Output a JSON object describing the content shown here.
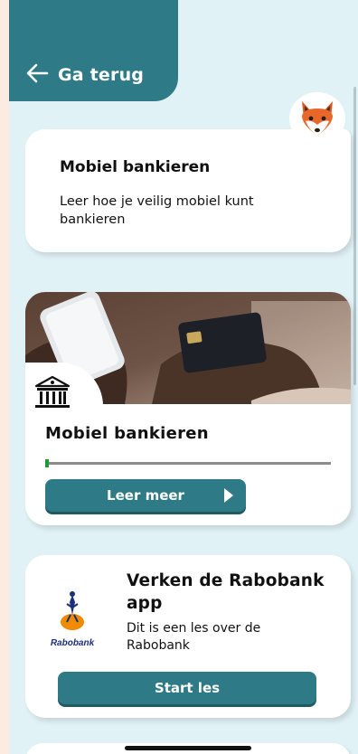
{
  "header": {
    "back_label": "Ga terug"
  },
  "intro": {
    "title": "Mobiel bankieren",
    "description": "Leer hoe je veilig mobiel kunt bankieren"
  },
  "course": {
    "title": "Mobiel bankieren",
    "progress": 0.01,
    "button_label": "Leer meer",
    "icon": "bank-building-icon"
  },
  "rabobank": {
    "title": "Verken de Rabobank app",
    "description": "Dit is een les over de Rabobank",
    "logo_text": "Rabobank",
    "button_label": "Start les"
  },
  "colors": {
    "accent": "#2e7a86",
    "background": "#e1f2f6",
    "progress": "#1e9a34",
    "page_edge": "#fcebe0"
  }
}
